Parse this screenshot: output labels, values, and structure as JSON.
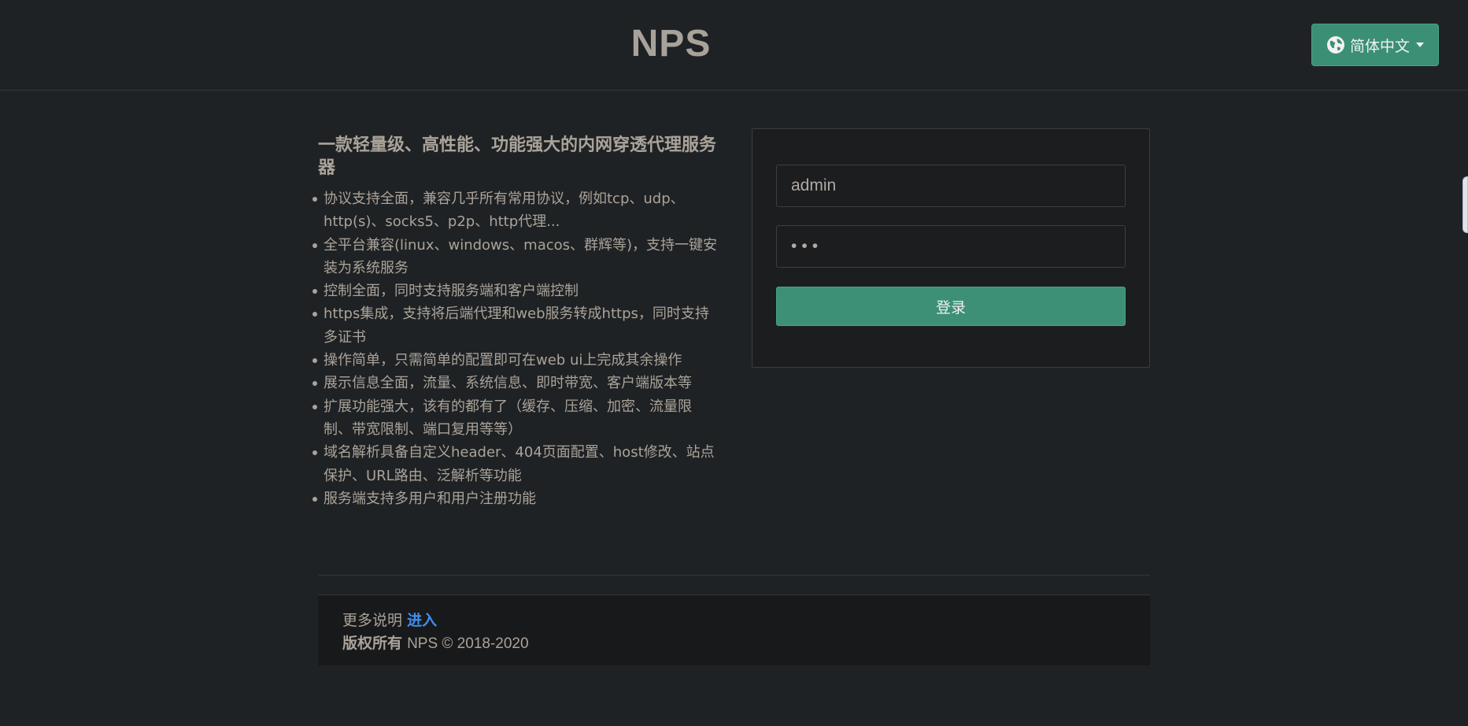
{
  "header": {
    "brand": "NPS",
    "language_button": {
      "label": "简体中文",
      "icon": "globe-icon"
    }
  },
  "intro": {
    "title": "一款轻量级、高性能、功能强大的内网穿透代理服务器",
    "features": [
      "协议支持全面，兼容几乎所有常用协议，例如tcp、udp、http(s)、socks5、p2p、http代理...",
      "全平台兼容(linux、windows、macos、群辉等)，支持一键安装为系统服务",
      "控制全面，同时支持服务端和客户端控制",
      "https集成，支持将后端代理和web服务转成https，同时支持多证书",
      "操作简单，只需简单的配置即可在web ui上完成其余操作",
      "展示信息全面，流量、系统信息、即时带宽、客户端版本等",
      "扩展功能强大，该有的都有了（缓存、压缩、加密、流量限制、带宽限制、端口复用等等）",
      "域名解析具备自定义header、404页面配置、host修改、站点保护、URL路由、泛解析等功能",
      "服务端支持多用户和用户注册功能"
    ]
  },
  "login": {
    "username_value": "admin",
    "password_value": "•••",
    "submit_label": "登录"
  },
  "footer": {
    "more_prefix": "更多说明",
    "more_link": "进入",
    "copyright_bold": "版权所有",
    "copyright_text": "NPS © 2018-2020"
  },
  "colors": {
    "background": "#1f2224",
    "accent": "#3d8f76",
    "link": "#3f8ef0"
  }
}
